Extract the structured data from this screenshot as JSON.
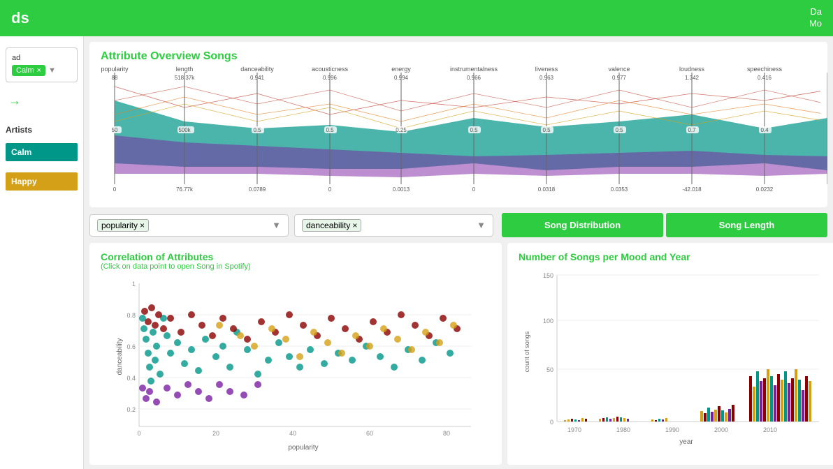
{
  "topBar": {
    "title": "ds",
    "rightText1": "Da",
    "rightText2": "Mo"
  },
  "sidebar": {
    "filterLabel": "ad",
    "tag": "Calm",
    "arrowLabel": "→",
    "artistsLabel": "Artists",
    "moods": [
      {
        "label": "Calm",
        "color": "#009688"
      },
      {
        "label": "Happy",
        "color": "#d4a017"
      }
    ]
  },
  "parallelChart": {
    "title": "Attribute Overview Songs",
    "axes": [
      {
        "name": "popularity",
        "max": "88",
        "mid": "50",
        "min": "0",
        "midVal": "0.5"
      },
      {
        "name": "length",
        "max": "518.37k",
        "mid": "500k",
        "min": "76.77k",
        "midVal": ""
      },
      {
        "name": "danceability",
        "max": "0.941",
        "min": "0.0789",
        "midVal": "0.5"
      },
      {
        "name": "acousticness",
        "max": "0.996",
        "min": "0",
        "midVal": "0.5"
      },
      {
        "name": "energy",
        "max": "0.994",
        "min": "0.0013",
        "midVal": "0.25"
      },
      {
        "name": "instrumentalness",
        "max": "0.966",
        "min": "0",
        "midVal": "0.5"
      },
      {
        "name": "liveness",
        "max": "0.963",
        "min": "0.0318",
        "midVal": "0.5"
      },
      {
        "name": "valence",
        "max": "0.977",
        "min": "0.0353",
        "midVal": "0.5"
      },
      {
        "name": "loudness",
        "max": "1.342",
        "min": "-42.018",
        "midVal": "0.7"
      },
      {
        "name": "speechiness",
        "max": "0.416",
        "min": "0.0232",
        "midVal": "0.4"
      }
    ]
  },
  "dropdowns": {
    "first": {
      "value": "popularity",
      "placeholder": "popularity"
    },
    "second": {
      "value": "danceability",
      "placeholder": "danceability"
    }
  },
  "tabs": {
    "songDistribution": "Song Distribution",
    "songLength": "Song Length"
  },
  "scatterChart": {
    "title": "Correlation of Attributes",
    "subtitle": "(Click on data point to open Song in Spotify)",
    "xLabel": "popularity",
    "yLabel": "danceability",
    "yMax": "1",
    "yTicks": [
      "1",
      "0.8",
      "0.6",
      "0.4",
      "0.2"
    ],
    "xTicks": [
      "0",
      "20",
      "40",
      "60",
      "80"
    ]
  },
  "barChart": {
    "title": "Number of Songs per Mood and Year",
    "yLabel": "count of songs",
    "xLabel": "year",
    "yTicks": [
      "150",
      "100",
      "50",
      "0"
    ],
    "xTicks": [
      "1970",
      "1980",
      "1990",
      "2000",
      "2010"
    ]
  }
}
